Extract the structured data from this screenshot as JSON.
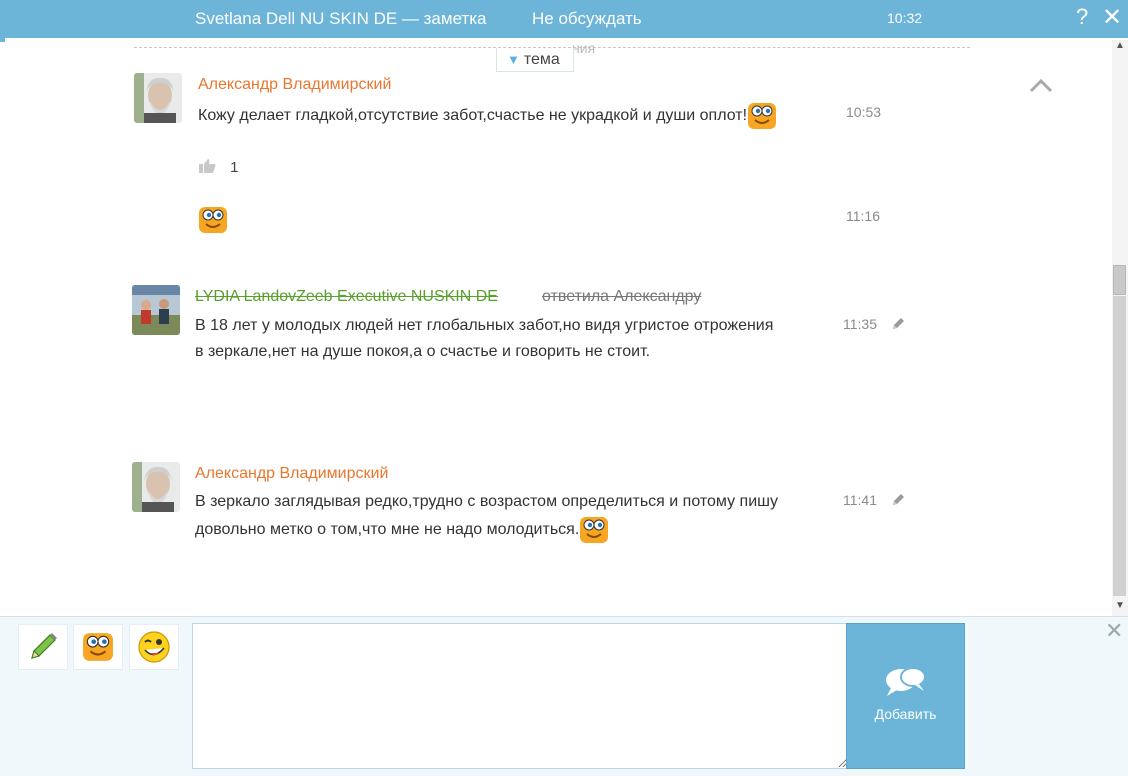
{
  "header": {
    "title": "Svetlana Dell NU SKIN DE — заметка",
    "action": "Не обсуждать",
    "time": "10:32",
    "help": "?",
    "close": "✕"
  },
  "topic": {
    "faded_text": "ния",
    "tab_label": "тема"
  },
  "messages": [
    {
      "author": "Александр Владимирский",
      "text": "Кожу делает гладкой,отсутствие забот,счастье не украдкой и души оплот!",
      "time": "10:53",
      "likes": "1"
    },
    {
      "time": "11:16"
    },
    {
      "author": "LYDIA LandovZeeb Executive NUSKIN DE",
      "reply_to": "ответила Александру",
      "text": "В 18 лет у молодых людей нет глобальных забот,но видя угристое отрожения в зеркале,нет на душе покоя,а о счастье и говорить не стоит.",
      "time": "11:35"
    },
    {
      "author": "Александр Владимирский",
      "text": "В зеркало заглядывая редко,трудно с возрастом определиться и потому пишу довольно метко о том,что мне не надо молодиться.",
      "time": "11:41"
    }
  ],
  "compose": {
    "send_label": "Добавить",
    "close": "✕",
    "input_value": ""
  },
  "colors": {
    "accent": "#6cb4d8",
    "author_orange": "#e8772e",
    "author_green": "#5aa02c"
  }
}
